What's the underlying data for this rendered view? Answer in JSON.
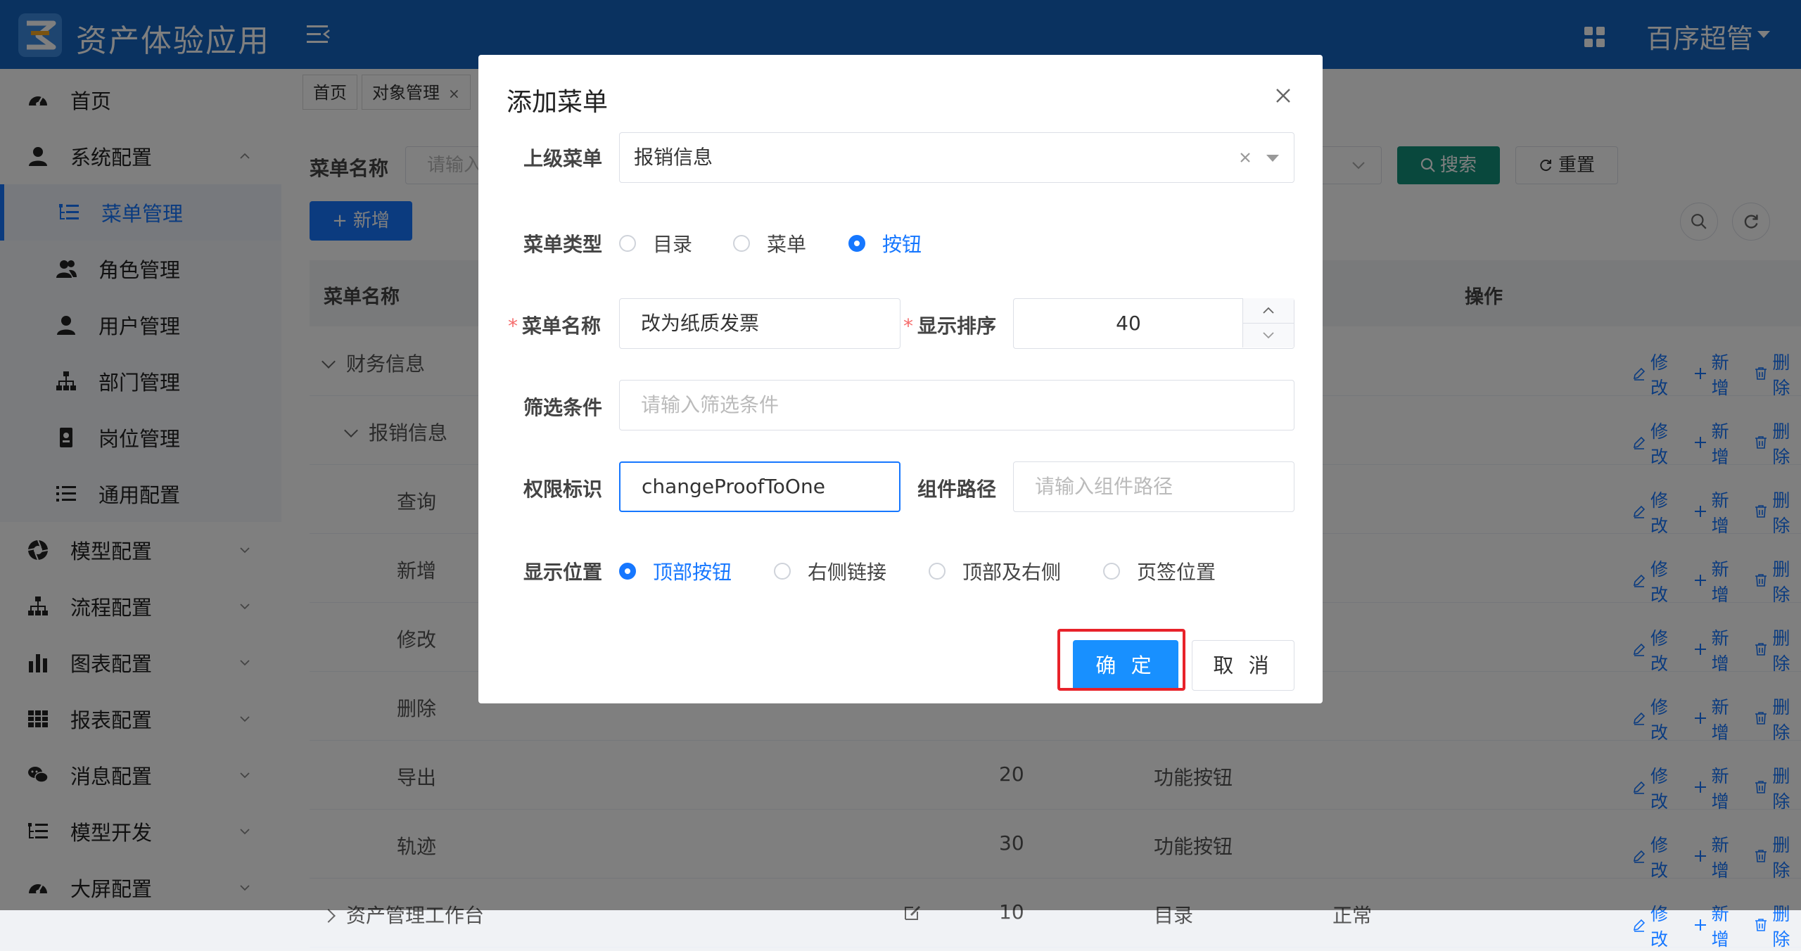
{
  "header": {
    "app_title": "资产体验应用",
    "user_name": "百序超管"
  },
  "sidebar": {
    "items": [
      {
        "label": "首页",
        "icon": "dashboard-icon"
      },
      {
        "label": "系统配置",
        "icon": "user-icon"
      },
      {
        "label": "菜单管理",
        "icon": "tree-list-icon"
      },
      {
        "label": "角色管理",
        "icon": "users-icon"
      },
      {
        "label": "用户管理",
        "icon": "user-icon"
      },
      {
        "label": "部门管理",
        "icon": "org-chart-icon"
      },
      {
        "label": "岗位管理",
        "icon": "id-card-icon"
      },
      {
        "label": "通用配置",
        "icon": "list-icon"
      },
      {
        "label": "模型配置",
        "icon": "aperture-icon"
      },
      {
        "label": "流程配置",
        "icon": "org-chart-icon"
      },
      {
        "label": "图表配置",
        "icon": "bar-chart-icon"
      },
      {
        "label": "报表配置",
        "icon": "table-icon"
      },
      {
        "label": "消息配置",
        "icon": "chat-icon"
      },
      {
        "label": "模型开发",
        "icon": "tree-list-icon"
      },
      {
        "label": "大屏配置",
        "icon": "dashboard-icon"
      }
    ]
  },
  "tabs": [
    {
      "label": "首页"
    },
    {
      "label": "对象管理",
      "close": "×"
    }
  ],
  "filter": {
    "label": "菜单名称",
    "placeholder": "请输入",
    "search": "搜索",
    "reset": "重置"
  },
  "toolbar": {
    "add": "新增"
  },
  "table": {
    "headers": {
      "name": "菜单名称",
      "ops": "操作"
    },
    "ops": {
      "edit": "修改",
      "add": "新增",
      "delete": "删除"
    },
    "rows": [
      {
        "name": "财务信息",
        "order": "",
        "type": "",
        "status": ""
      },
      {
        "name": "报销信息",
        "order": "",
        "type": "",
        "status": ""
      },
      {
        "name": "查询",
        "order": "",
        "type": "",
        "status": ""
      },
      {
        "name": "新增",
        "order": "",
        "type": "",
        "status": ""
      },
      {
        "name": "修改",
        "order": "",
        "type": "",
        "status": ""
      },
      {
        "name": "删除",
        "order": "",
        "type": "",
        "status": ""
      },
      {
        "name": "导出",
        "order": "20",
        "type": "功能按钮",
        "status": ""
      },
      {
        "name": "轨迹",
        "order": "30",
        "type": "功能按钮",
        "status": ""
      },
      {
        "name": "资产管理工作台",
        "order": "10",
        "type": "目录",
        "status": "正常"
      }
    ]
  },
  "dialog": {
    "title": "添加菜单",
    "parent_label": "上级菜单",
    "parent_value": "报销信息",
    "type_label": "菜单类型",
    "type_options": [
      "目录",
      "菜单",
      "按钮"
    ],
    "type_selected": "按钮",
    "name_label": "菜单名称",
    "name_value": "改为纸质发票",
    "order_label": "显示排序",
    "order_value": "40",
    "filter_label": "筛选条件",
    "filter_placeholder": "请输入筛选条件",
    "perm_label": "权限标识",
    "perm_value": "changeProofToOne",
    "component_label": "组件路径",
    "component_placeholder": "请输入组件路径",
    "position_label": "显示位置",
    "position_options": [
      "顶部按钮",
      "右侧链接",
      "顶部及右侧",
      "页签位置"
    ],
    "position_selected": "顶部按钮",
    "ok": "确 定",
    "cancel": "取 消"
  },
  "colors": {
    "primary": "#1677ff",
    "header": "#1565c0",
    "search": "#13917b",
    "highlight": "#e8222a"
  }
}
